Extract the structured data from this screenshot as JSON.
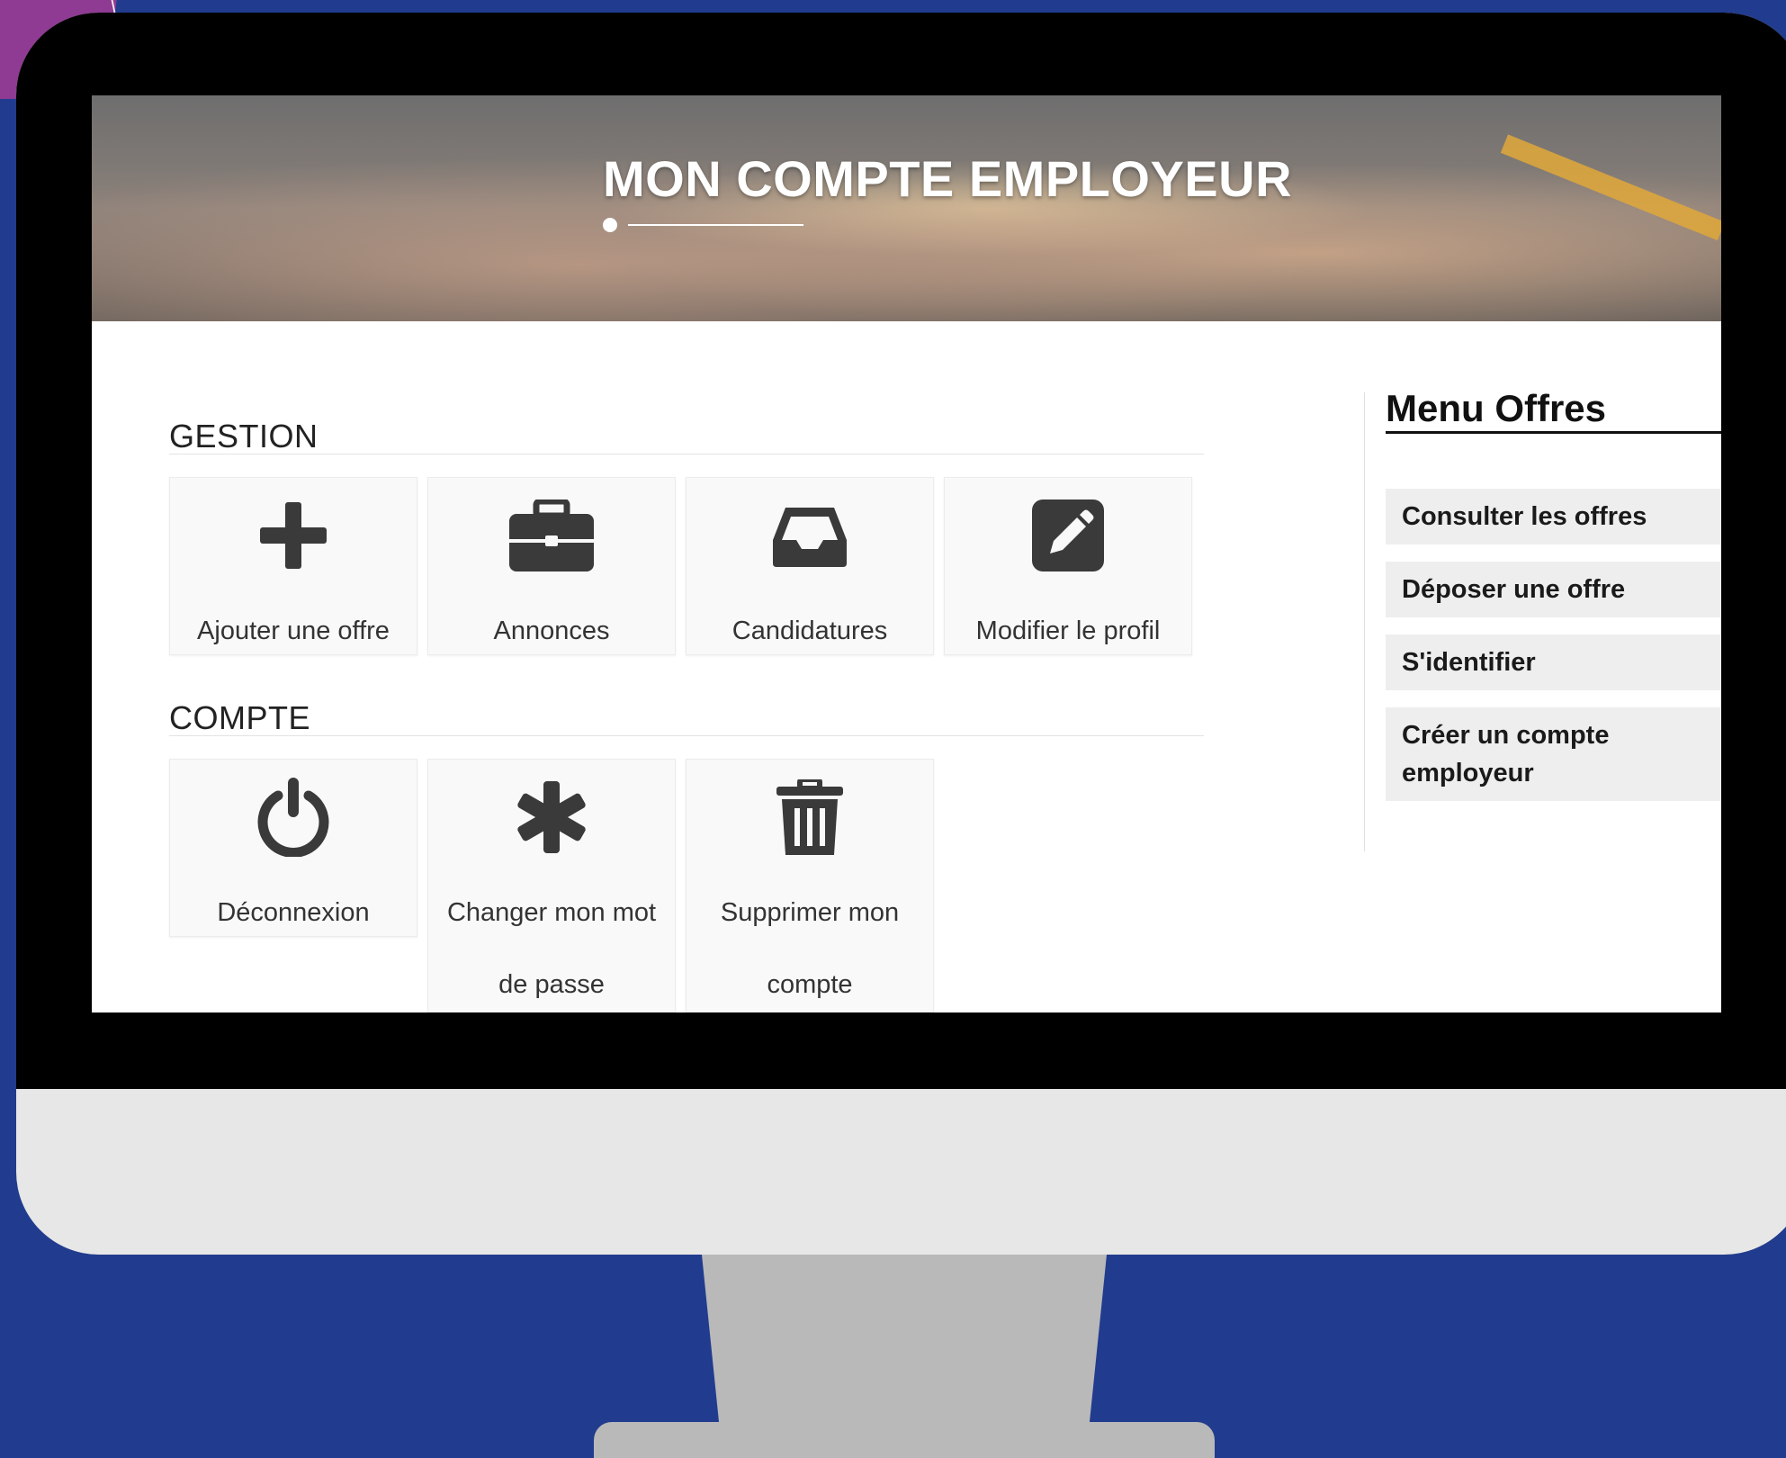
{
  "page": {
    "hero_title": "MON COMPTE EMPLOYEUR"
  },
  "gestion": {
    "title": "GESTION",
    "tiles": [
      {
        "label": "Ajouter une offre",
        "icon": "plus-icon"
      },
      {
        "label": "Annonces",
        "icon": "briefcase-icon"
      },
      {
        "label": "Candidatures",
        "icon": "inbox-icon"
      },
      {
        "label": "Modifier le profil",
        "icon": "edit-icon"
      }
    ]
  },
  "compte": {
    "title": "COMPTE",
    "tiles": [
      {
        "label": "Déconnexion",
        "icon": "power-icon"
      },
      {
        "label": "Changer mon mot de passe",
        "icon": "asterisk-icon"
      },
      {
        "label": "Supprimer mon compte",
        "icon": "trash-icon"
      }
    ]
  },
  "sidebar": {
    "title": "Menu Offres",
    "items": [
      {
        "label": "Consulter les offres"
      },
      {
        "label": "Déposer une offre"
      },
      {
        "label": "S'identifier"
      },
      {
        "label": "Créer un compte employeur"
      }
    ]
  },
  "colors": {
    "background": "#213c8e",
    "icon": "#3a3a3a",
    "tile": "#f9f9f9",
    "menu_item": "#eeeeee"
  }
}
